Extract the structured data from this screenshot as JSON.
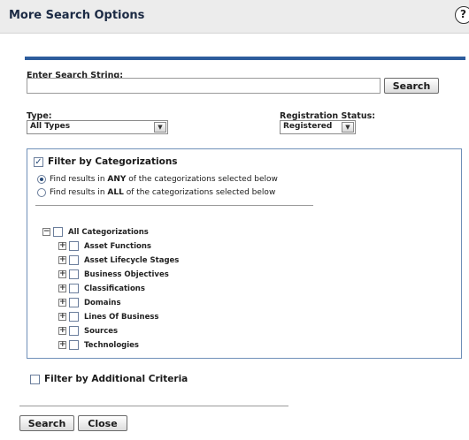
{
  "dialog": {
    "title": "More Search Options",
    "help_glyph": "?"
  },
  "search": {
    "label": "Enter Search String:",
    "value": "",
    "button_label": "Search"
  },
  "type": {
    "label": "Type:",
    "selected": "All Types"
  },
  "registration_status": {
    "label": "Registration Status:",
    "selected": "Registered"
  },
  "filter_categorizations": {
    "label": "Filter by Categorizations",
    "checked": true,
    "options": [
      {
        "prefix": "Find results in ",
        "emph": "ANY",
        "suffix": " of the categorizations selected below",
        "selected": true
      },
      {
        "prefix": "Find results in ",
        "emph": "ALL",
        "suffix": " of the categorizations selected below",
        "selected": false
      }
    ],
    "tree": {
      "root": {
        "label": "All Categorizations",
        "expander": "−"
      },
      "children": [
        {
          "label": "Asset Functions",
          "expander": "+"
        },
        {
          "label": "Asset Lifecycle Stages",
          "expander": "+"
        },
        {
          "label": "Business Objectives",
          "expander": "+"
        },
        {
          "label": "Classifications",
          "expander": "+"
        },
        {
          "label": "Domains",
          "expander": "+"
        },
        {
          "label": "Lines Of Business",
          "expander": "+"
        },
        {
          "label": "Sources",
          "expander": "+"
        },
        {
          "label": "Technologies",
          "expander": "+"
        }
      ]
    }
  },
  "filter_additional": {
    "label": "Filter by Additional Criteria",
    "checked": false
  },
  "footer": {
    "search_label": "Search",
    "close_label": "Close"
  },
  "icons": {
    "help": "help-icon",
    "check": "checkmark-icon",
    "expand": "plus-box-icon",
    "collapse": "minus-box-icon",
    "dropdown": "chevron-down-icon"
  }
}
